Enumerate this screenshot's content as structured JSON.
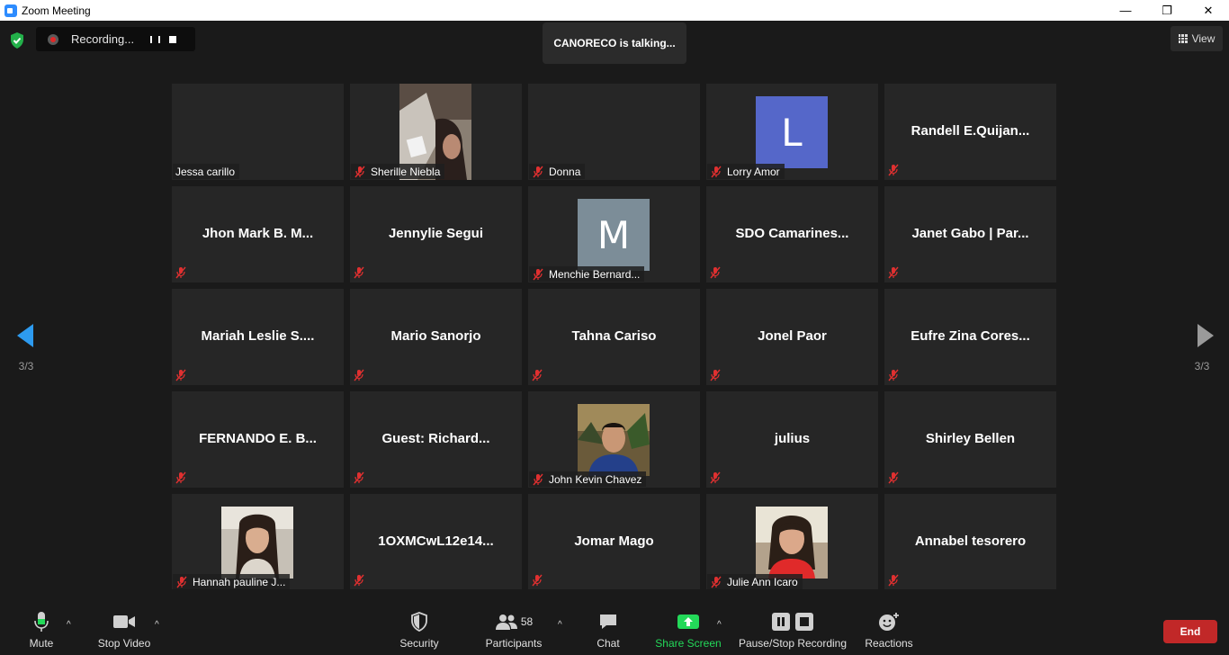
{
  "window": {
    "title": "Zoom Meeting",
    "controls": [
      "—",
      "❐",
      "✕"
    ]
  },
  "recording": {
    "label": "Recording..."
  },
  "talking": {
    "text": "CANORECO is talking..."
  },
  "view": {
    "label": "View"
  },
  "pager": {
    "left": "3/3",
    "right": "3/3"
  },
  "tiles": [
    {
      "name": "",
      "label": "Jessa carillo",
      "muted": false,
      "kind": "empty"
    },
    {
      "name": "",
      "label": "Sherille Niebla",
      "muted": true,
      "kind": "photo-sherille"
    },
    {
      "name": "",
      "label": "Donna",
      "muted": true,
      "kind": "empty"
    },
    {
      "name": "",
      "label": "Lorry Amor",
      "muted": true,
      "kind": "avatar",
      "initial": "L",
      "color": "#5567c9"
    },
    {
      "name": "Randell  E.Quijan...",
      "label": "",
      "muted": true,
      "kind": "text"
    },
    {
      "name": "Jhon Mark B. M...",
      "label": "",
      "muted": true,
      "kind": "text"
    },
    {
      "name": "Jennylie Segui",
      "label": "",
      "muted": true,
      "kind": "text"
    },
    {
      "name": "",
      "label": "Menchie Bernard...",
      "muted": true,
      "kind": "avatar",
      "initial": "M",
      "color": "#7c8d98"
    },
    {
      "name": "SDO  Camarines...",
      "label": "",
      "muted": true,
      "kind": "text"
    },
    {
      "name": "Janet Gabo | Par...",
      "label": "",
      "muted": true,
      "kind": "text"
    },
    {
      "name": "Mariah  Leslie  S....",
      "label": "",
      "muted": true,
      "kind": "text"
    },
    {
      "name": "Mario Sanorjo",
      "label": "",
      "muted": true,
      "kind": "text"
    },
    {
      "name": "Tahna Cariso",
      "label": "",
      "muted": true,
      "kind": "text"
    },
    {
      "name": "Jonel Paor",
      "label": "",
      "muted": true,
      "kind": "text"
    },
    {
      "name": "Eufre  Zina  Cores...",
      "label": "",
      "muted": true,
      "kind": "text"
    },
    {
      "name": "FERNANDO E. B...",
      "label": "",
      "muted": true,
      "kind": "text"
    },
    {
      "name": "Guest:  Richard...",
      "label": "",
      "muted": true,
      "kind": "text"
    },
    {
      "name": "",
      "label": "John Kevin Chavez",
      "muted": true,
      "kind": "photo-john"
    },
    {
      "name": "julius",
      "label": "",
      "muted": true,
      "kind": "text"
    },
    {
      "name": "Shirley Bellen",
      "label": "",
      "muted": true,
      "kind": "text"
    },
    {
      "name": "",
      "label": "Hannah pauline J...",
      "muted": true,
      "kind": "photo-hannah"
    },
    {
      "name": "1OXMCwL12e14...",
      "label": "",
      "muted": true,
      "kind": "text"
    },
    {
      "name": "Jomar Mago",
      "label": "",
      "muted": true,
      "kind": "text"
    },
    {
      "name": "",
      "label": "Julie Ann Icaro",
      "muted": true,
      "kind": "photo-julie"
    },
    {
      "name": "Annabel tesorero",
      "label": "",
      "muted": true,
      "kind": "text"
    }
  ],
  "toolbar": {
    "mute": "Mute",
    "stop_video": "Stop Video",
    "security": "Security",
    "participants": "Participants",
    "participants_count": "58",
    "chat": "Chat",
    "share_screen": "Share Screen",
    "recording": "Pause/Stop Recording",
    "reactions": "Reactions",
    "end": "End"
  },
  "colors": {
    "share_green": "#23d959",
    "end_red": "#c12828",
    "mute_red": "#e03030"
  }
}
